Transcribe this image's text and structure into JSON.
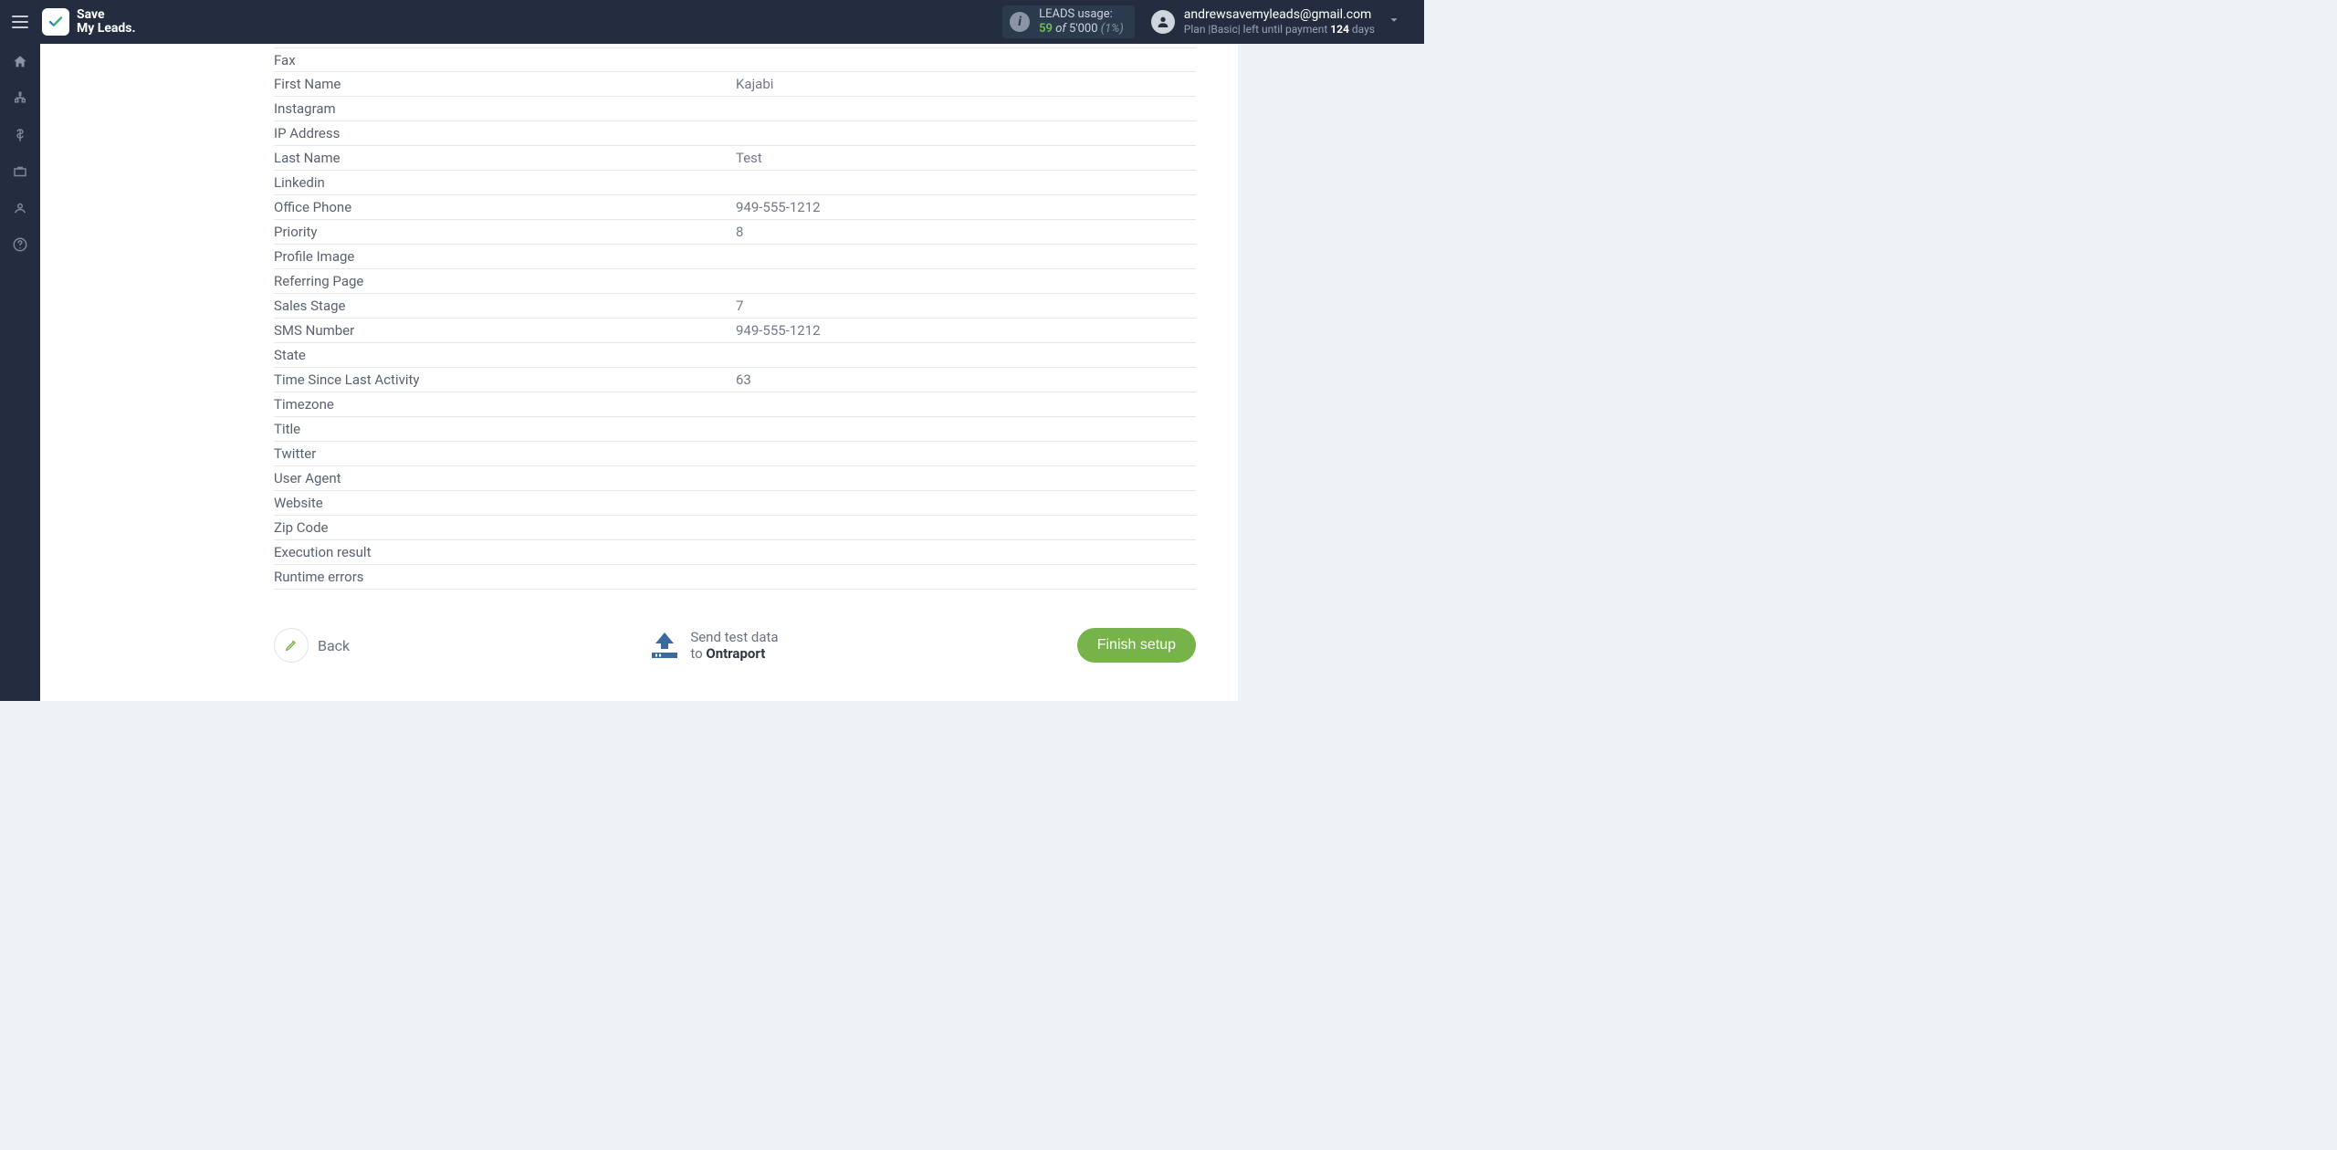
{
  "brand": {
    "name_line1": "Save",
    "name_line2": "My Leads."
  },
  "leads_usage": {
    "title": "LEADS usage:",
    "used": "59",
    "of_word": "of",
    "max": "5'000",
    "pct": "(1%)"
  },
  "user": {
    "email": "andrewsavemyleads@gmail.com",
    "plan_prefix": "Plan |",
    "plan_name": "Basic",
    "plan_mid": "| left until payment ",
    "days": "124",
    "days_suffix": " days"
  },
  "fields": [
    {
      "label": "Fax",
      "value": ""
    },
    {
      "label": "First Name",
      "value": "Kajabi"
    },
    {
      "label": "Instagram",
      "value": ""
    },
    {
      "label": "IP Address",
      "value": ""
    },
    {
      "label": "Last Name",
      "value": "Test"
    },
    {
      "label": "Linkedin",
      "value": ""
    },
    {
      "label": "Office Phone",
      "value": "949-555-1212"
    },
    {
      "label": "Priority",
      "value": "8"
    },
    {
      "label": "Profile Image",
      "value": ""
    },
    {
      "label": "Referring Page",
      "value": ""
    },
    {
      "label": "Sales Stage",
      "value": "7"
    },
    {
      "label": "SMS Number",
      "value": "949-555-1212"
    },
    {
      "label": "State",
      "value": ""
    },
    {
      "label": "Time Since Last Activity",
      "value": "63"
    },
    {
      "label": "Timezone",
      "value": ""
    },
    {
      "label": "Title",
      "value": ""
    },
    {
      "label": "Twitter",
      "value": ""
    },
    {
      "label": "User Agent",
      "value": ""
    },
    {
      "label": "Website",
      "value": ""
    },
    {
      "label": "Zip Code",
      "value": ""
    },
    {
      "label": "Execution result",
      "value": ""
    },
    {
      "label": "Runtime errors",
      "value": ""
    }
  ],
  "actions": {
    "back_label": "Back",
    "send_line1": "Send test data",
    "send_line2_prefix": "to ",
    "send_dest": "Ontraport",
    "finish_label": "Finish setup"
  }
}
